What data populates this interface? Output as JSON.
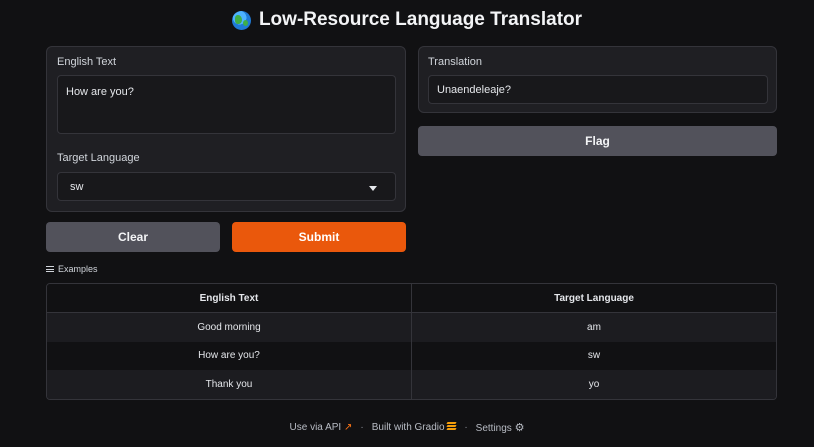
{
  "title": "Low-Resource Language Translator",
  "title_icon": "globe-icon",
  "input_panel": {
    "english_label": "English Text",
    "english_value": "How are you?",
    "target_label": "Target Language",
    "target_value": "sw"
  },
  "output_panel": {
    "translation_label": "Translation",
    "translation_value": "Unaendeleaje?"
  },
  "buttons": {
    "clear": "Clear",
    "submit": "Submit",
    "flag": "Flag"
  },
  "examples": {
    "heading": "Examples",
    "columns": [
      "English Text",
      "Target Language"
    ],
    "rows": [
      [
        "Good morning",
        "am"
      ],
      [
        "How are you?",
        "sw"
      ],
      [
        "Thank you",
        "yo"
      ]
    ]
  },
  "footer": {
    "api": "Use via API",
    "built": "Built with Gradio",
    "settings": "Settings"
  },
  "colors": {
    "accent": "#ea580c",
    "secondary_button": "#52525b",
    "panel": "#1f1f23",
    "background": "#111113"
  }
}
